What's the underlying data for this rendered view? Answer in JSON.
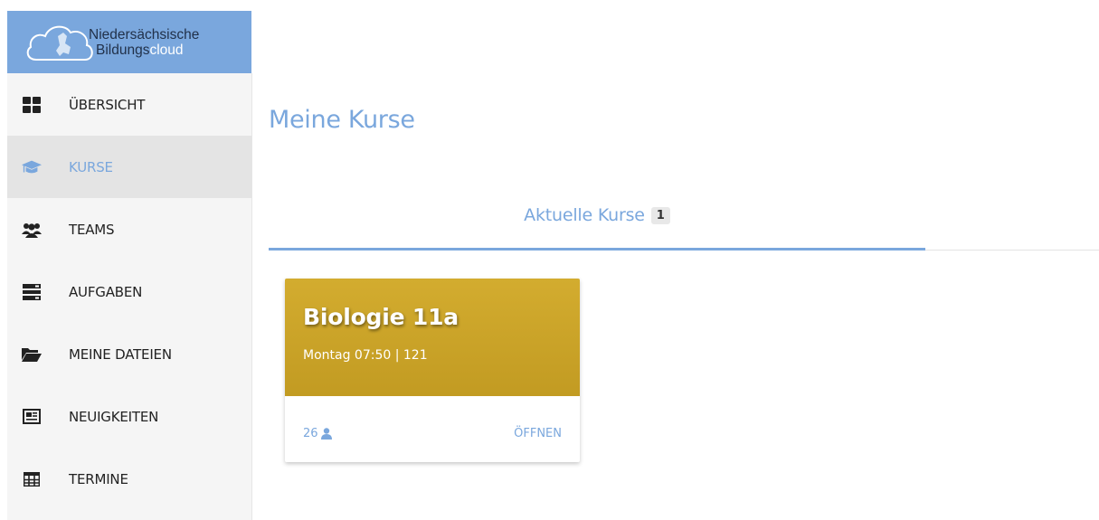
{
  "app": {
    "logo_line1": "Niedersächsische",
    "logo_line2_a": "Bildungs",
    "logo_line2_b": "cloud"
  },
  "sidebar": {
    "items": [
      {
        "label": "ÜBERSICHT",
        "icon": "dashboard-icon"
      },
      {
        "label": "KURSE",
        "icon": "graduation-cap-icon",
        "active": true
      },
      {
        "label": "TEAMS",
        "icon": "users-icon"
      },
      {
        "label": "AUFGABEN",
        "icon": "tasks-icon"
      },
      {
        "label": "MEINE DATEIEN",
        "icon": "folder-open-icon"
      },
      {
        "label": "NEUIGKEITEN",
        "icon": "newspaper-icon"
      },
      {
        "label": "TERMINE",
        "icon": "table-icon"
      }
    ]
  },
  "main": {
    "title": "Meine Kurse",
    "tabs": [
      {
        "label": "Aktuelle Kurse",
        "count": "1",
        "active": true
      }
    ],
    "courses": [
      {
        "title": "Biologie 11a",
        "schedule": "Montag 07:50 | 121",
        "members": "26",
        "open_label": "ÖFFNEN",
        "color": "#c9a227"
      }
    ]
  },
  "colors": {
    "accent": "#7aa7dd",
    "sidebar_bg": "#f5f5f5",
    "active_bg": "#e4e4e4"
  }
}
